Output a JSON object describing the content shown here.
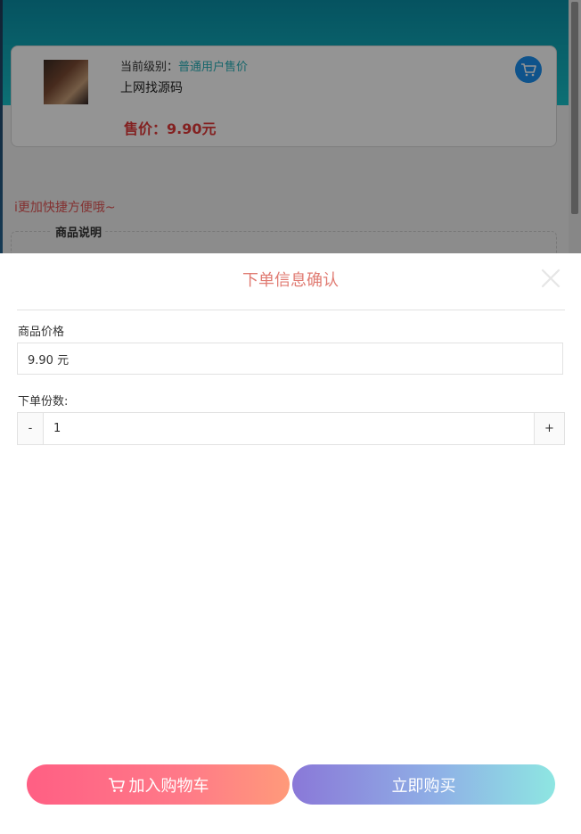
{
  "background": {
    "level_label": "当前级别：",
    "level_value": "普通用户售价",
    "product_name": "上网找源码",
    "price_text": "售价：9.90元",
    "tip_text": "i更加快捷方便哦~",
    "description_title": "商品说明"
  },
  "modal": {
    "title": "下单信息确认",
    "price_label": "商品价格",
    "price_value": "9.90 元",
    "quantity_label": "下单份数:",
    "minus_label": "-",
    "quantity_value": "1",
    "plus_label": "+",
    "add_to_cart_label": "加入购物车",
    "buy_now_label": "立即购买"
  },
  "colors": {
    "header": "#17c0c8",
    "title": "#e07b72",
    "price": "#e23a3a",
    "add_cart_gradient": [
      "#ff5f84",
      "#ff9a7a"
    ],
    "buy_now_gradient": [
      "#8a78d8",
      "#8ee6e2"
    ]
  },
  "icons": [
    "cart-icon",
    "close-icon",
    "product-thumbnail"
  ]
}
